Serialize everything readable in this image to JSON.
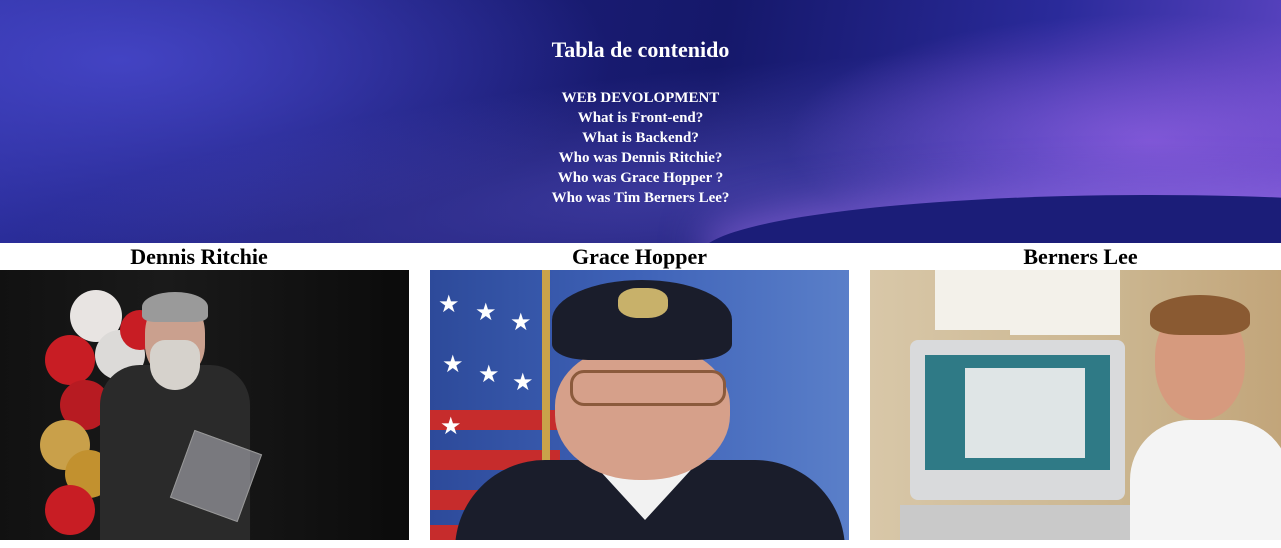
{
  "header": {
    "title": "Tabla de contenido",
    "toc": [
      "WEB DEVOLOPMENT",
      "What is Front-end?",
      "What is Backend?",
      "Who was Dennis Ritchie?",
      "Who was Grace Hopper ?",
      "Who was Tim Berners Lee?"
    ]
  },
  "gallery": [
    {
      "name": "Dennis Ritchie"
    },
    {
      "name": "Grace Hopper"
    },
    {
      "name": "Berners Lee"
    }
  ],
  "colors": {
    "hero_dark": "#15186a",
    "hero_accent": "#5c45c2",
    "text_light": "#ffffff",
    "text_dark": "#000000"
  }
}
